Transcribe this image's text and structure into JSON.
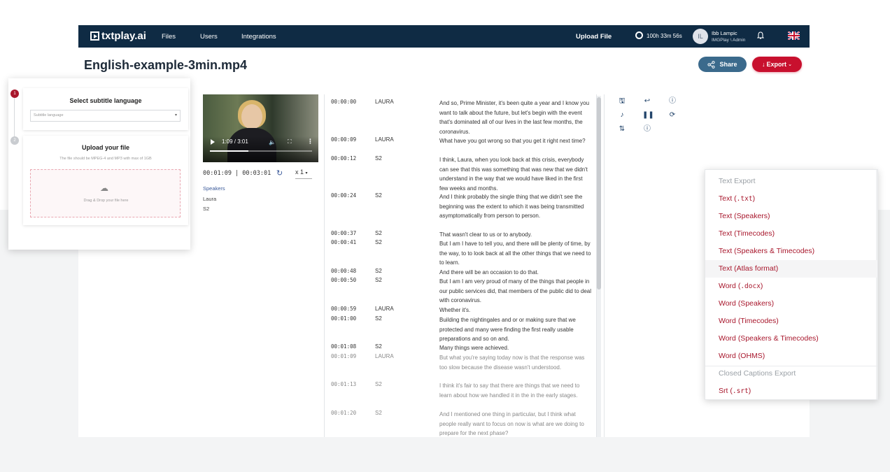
{
  "nav": {
    "logo": "txtplay.ai",
    "links": [
      "Files",
      "Users",
      "Integrations"
    ],
    "upload": "Upload File",
    "time_balance": "100h 33m 56s",
    "avatar_initials": "IL",
    "user_name": "Ibb Lampic",
    "user_role": "IMGPlay \\ Admin"
  },
  "page": {
    "title": "English-example-3min.mp4",
    "share_label": "Share",
    "export_label": "Export"
  },
  "player": {
    "video_time": "1:09 / 3:01",
    "position": "00:01:09 | 00:03:01",
    "speed": "x 1",
    "progress": 0.38
  },
  "speakers": {
    "heading": "Speakers",
    "items": [
      "Laura",
      "S2"
    ]
  },
  "transcript": [
    {
      "tc": "00:00:00",
      "sp": "LAURA",
      "text": "And so, Prime Minister, it's been quite a year and I know you want to talk about the future, but let's begin with the event that's dominated all of our lives in the last few months, the coronavirus.",
      "dim": false
    },
    {
      "tc": "00:00:09",
      "sp": "LAURA",
      "text": "What have you got wrong so that you get it right next time?",
      "dim": false
    },
    {
      "tc": "00:00:12",
      "sp": "S2",
      "text": "I think, Laura, when you look back at this crisis, everybody can see that this was something that was new that we didn't understand in the way that we would have liked in the first few weeks and months.",
      "dim": false
    },
    {
      "tc": "00:00:24",
      "sp": "S2",
      "text": "And I think probably the single thing that we didn't see the beginning was the extent to which it was being transmitted asymptomatically from person to person.",
      "dim": false
    },
    {
      "tc": "00:00:37",
      "sp": "S2",
      "text": "That wasn't clear to us or to anybody.",
      "dim": false
    },
    {
      "tc": "00:00:41",
      "sp": "S2",
      "text": "But I am I have to tell you, and there will be plenty of time, by the way, to to look back at all the other things that we need to to learn.",
      "dim": false
    },
    {
      "tc": "00:00:48",
      "sp": "S2",
      "text": "And there will be an occasion to do that.",
      "dim": false
    },
    {
      "tc": "00:00:50",
      "sp": "S2",
      "text": "But I am I am very proud of many of the things that people in our public services did, that members of the public did to deal with coronavirus.",
      "dim": false
    },
    {
      "tc": "00:00:59",
      "sp": "LAURA",
      "text": "Whether it's.",
      "dim": false
    },
    {
      "tc": "00:01:00",
      "sp": "S2",
      "text": "Building the nightingales and or or making sure that we protected and many were finding the first really usable preparations and so on and.",
      "dim": false
    },
    {
      "tc": "00:01:08",
      "sp": "S2",
      "text": "Many things were achieved.",
      "dim": false
    },
    {
      "tc": "00:01:09",
      "sp": "LAURA",
      "text": "But what you're saying today now is that the response was too slow because the disease wasn't understood.",
      "dim": true
    },
    {
      "tc": "00:01:13",
      "sp": "S2",
      "text": "I think it's fair to say that there are things that we need to learn about how we handled it in the in the early stages.",
      "dim": true
    },
    {
      "tc": "00:01:20",
      "sp": "S2",
      "text": "And I mentioned one thing in particular, but I think what people really want to focus on now is what are we doing to prepare for the next phase?",
      "dim": true
    }
  ],
  "subtitle_panel": {
    "step1": "1",
    "step2": "2",
    "select_title": "Select subtitle language",
    "select_placeholder": "Subtitle language",
    "upload_title": "Upload your file",
    "upload_hint": "The file should be MPEG-4 and MP3 with max of 1GB",
    "drop_text": "Drag & Drop your file here"
  },
  "export_menu": [
    {
      "label": "Text Export",
      "type": "head"
    },
    {
      "label": "Text (",
      "code": ".txt",
      "suffix": ")",
      "type": "item"
    },
    {
      "label": "Text (Speakers)",
      "type": "item"
    },
    {
      "label": "Text (Timecodes)",
      "type": "item"
    },
    {
      "label": "Text (Speakers & Timecodes)",
      "type": "item"
    },
    {
      "label": "Text (Atlas format)",
      "type": "hover"
    },
    {
      "label": "Word (",
      "code": ".docx",
      "suffix": ")",
      "type": "item"
    },
    {
      "label": "Word (Speakers)",
      "type": "item"
    },
    {
      "label": "Word (Timecodes)",
      "type": "item"
    },
    {
      "label": "Word (Speakers & Timecodes)",
      "type": "item"
    },
    {
      "label": "Word (OHMS)",
      "type": "item"
    },
    {
      "label": "Closed Captions Export",
      "type": "head"
    },
    {
      "label": "Srt (",
      "code": ".srt",
      "suffix": ")",
      "type": "item"
    }
  ],
  "colors": {
    "nav_bg": "#0f2b44",
    "share": "#3b6a8c",
    "export": "#c8102e",
    "menu_text": "#a8172c"
  }
}
